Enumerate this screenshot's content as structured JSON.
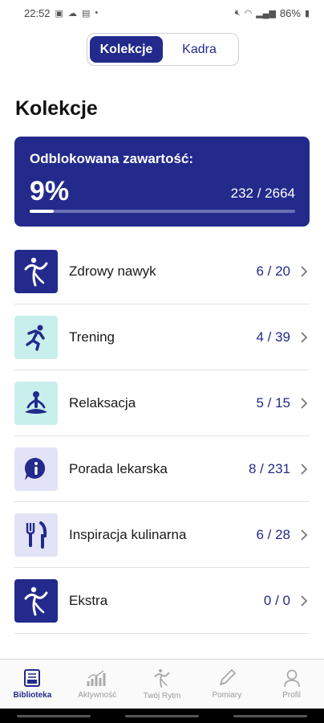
{
  "status_bar": {
    "time": "22:52",
    "battery": "86%"
  },
  "segment": {
    "tab1": "Kolekcje",
    "tab2": "Kadra"
  },
  "page_title": "Kolekcje",
  "progress": {
    "label": "Odblokowana zawartość:",
    "percent_text": "9%",
    "count_text": "232 / 2664",
    "fraction": 0.09
  },
  "collections": [
    {
      "label": "Zdrowy nawyk",
      "count": "6 / 20",
      "icon": "dancer-logo-icon",
      "thumb_bg": "#232a8c",
      "icon_color": "#ffffff"
    },
    {
      "label": "Trening",
      "count": "4 / 39",
      "icon": "runner-icon",
      "thumb_bg": "#c9efec",
      "icon_color": "#232a8c"
    },
    {
      "label": "Relaksacja",
      "count": "5 / 15",
      "icon": "meditation-icon",
      "thumb_bg": "#c9efec",
      "icon_color": "#232a8c"
    },
    {
      "label": "Porada lekarska",
      "count": "8 / 231",
      "icon": "info-bubble-icon",
      "thumb_bg": "#e2e3f6",
      "icon_color": "#232a8c"
    },
    {
      "label": "Inspiracja kulinarna",
      "count": "6 / 28",
      "icon": "fork-knife-icon",
      "thumb_bg": "#e2e3f6",
      "icon_color": "#232a8c"
    },
    {
      "label": "Ekstra",
      "count": "0 / 0",
      "icon": "dancer-logo-icon",
      "thumb_bg": "#232a8c",
      "icon_color": "#ffffff"
    }
  ],
  "bottom_nav": [
    {
      "label": "Biblioteka",
      "icon": "library-icon",
      "active": true
    },
    {
      "label": "Aktywność",
      "icon": "activity-chart-icon",
      "active": false
    },
    {
      "label": "Twój Rytm",
      "icon": "rhythm-figure-icon",
      "active": false
    },
    {
      "label": "Pomiary",
      "icon": "pen-icon",
      "active": false
    },
    {
      "label": "Profil",
      "icon": "profile-icon",
      "active": false
    }
  ],
  "colors": {
    "accent": "#232a8c",
    "mint": "#c9efec",
    "lavender": "#e2e3f6"
  }
}
